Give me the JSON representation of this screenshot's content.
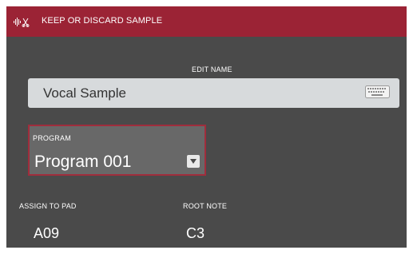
{
  "header": {
    "title": "KEEP OR DISCARD SAMPLE",
    "icon": "waveform-scissors-icon"
  },
  "edit_name": {
    "label": "EDIT NAME",
    "value": "Vocal Sample",
    "icon": "keyboard-icon"
  },
  "program": {
    "label": "PROGRAM",
    "value": "Program 001",
    "icon": "chevron-down-icon"
  },
  "assign_to_pad": {
    "label": "ASSIGN TO PAD",
    "value": "A09"
  },
  "root_note": {
    "label": "ROOT NOTE",
    "value": "C3"
  },
  "colors": {
    "header": "#9b2335",
    "background": "#4a4a4a",
    "field": "#d7dadc",
    "selected_border": "#a02d3c"
  }
}
